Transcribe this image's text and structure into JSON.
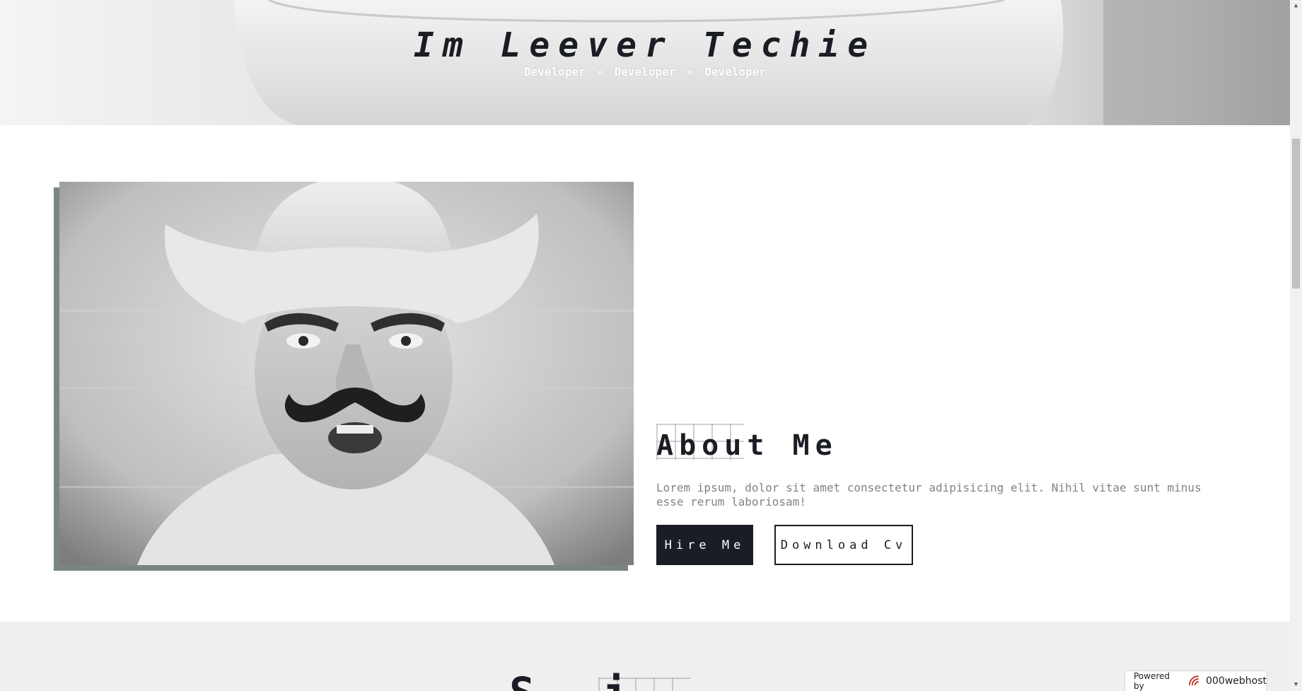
{
  "hero": {
    "title": "Im Leever Techie",
    "breadcrumb": [
      "Developer",
      "Developer",
      "Developer"
    ],
    "separator": "»"
  },
  "about": {
    "title": "About Me",
    "description": "Lorem ipsum, dolor sit amet consectetur adipisicing elit. Nihil vitae sunt minus esse rerum laboriosam!",
    "hire_label": "Hire Me",
    "cv_label": "Download Cv"
  },
  "next_section": {
    "title_partial": "S i"
  },
  "badge": {
    "label": "Powered by",
    "brand": "000webhost"
  },
  "colors": {
    "dark": "#1b1d24",
    "shadow_frame": "#7a8586",
    "muted_text": "#7d8488",
    "section_bg": "#efefef"
  }
}
